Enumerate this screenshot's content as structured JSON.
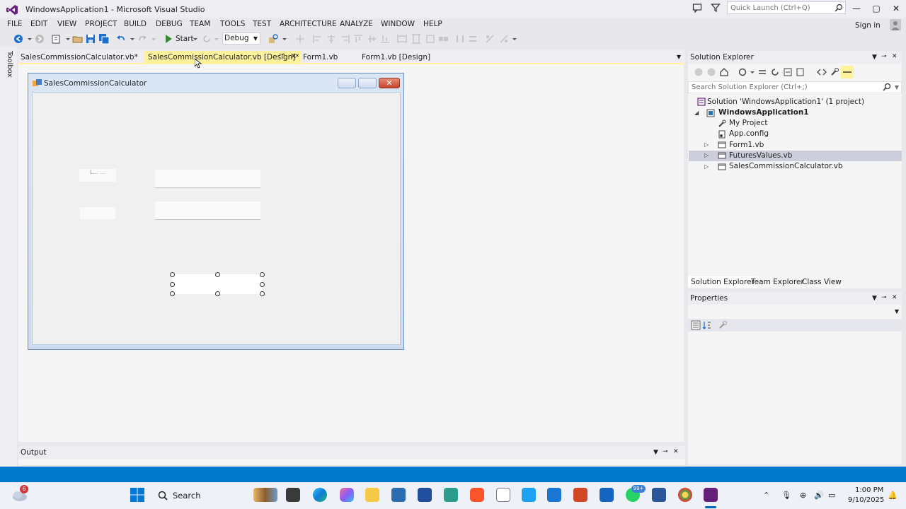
{
  "window": {
    "title": "WindowsApplication1 - Microsoft Visual Studio",
    "quick_launch_placeholder": "Quick Launch (Ctrl+Q)",
    "sign_in": "Sign in",
    "minimize": "—",
    "maximize": "▢",
    "close": "✕"
  },
  "menu": [
    "FILE",
    "EDIT",
    "VIEW",
    "PROJECT",
    "BUILD",
    "DEBUG",
    "TEAM",
    "TOOLS",
    "TEST",
    "ARCHITECTURE",
    "ANALYZE",
    "WINDOW",
    "HELP"
  ],
  "toolbar": {
    "start_label": "Start",
    "config_value": "Debug"
  },
  "toolbox": {
    "label": "Toolbox"
  },
  "tabs": [
    {
      "label": "SalesCommissionCalculator.vb*"
    },
    {
      "label": "SalesCommissionCalculator.vb [Design]*",
      "active": true
    },
    {
      "label": "Form1.vb"
    },
    {
      "label": "Form1.vb [Design]"
    }
  ],
  "form": {
    "title": "SalesCommissionCalculator",
    "label1_text": "L... ...",
    "minimize": "—",
    "maximize": "▢",
    "close": "✕"
  },
  "solution_explorer": {
    "title": "Solution Explorer",
    "search_placeholder": "Search Solution Explorer (Ctrl+;)",
    "solution": "Solution 'WindowsApplication1' (1 project)",
    "project": "WindowsApplication1",
    "items": [
      {
        "label": "My Project"
      },
      {
        "label": "App.config"
      },
      {
        "label": "Form1.vb"
      },
      {
        "label": "FuturesValues.vb",
        "selected": true
      },
      {
        "label": "SalesCommissionCalculator.vb"
      }
    ],
    "bottom_tabs": [
      "Solution Explorer",
      "Team Explorer",
      "Class View"
    ]
  },
  "properties": {
    "title": "Properties"
  },
  "output": {
    "title": "Output"
  },
  "taskbar": {
    "weather_badge": "6",
    "search_label": "Search",
    "whatsapp_badge": "99+",
    "time": "1:00 PM",
    "date": "9/10/2025"
  },
  "colors": {
    "accent": "#007acc",
    "active_tab": "#fff29d",
    "vs_purple": "#68217a"
  }
}
